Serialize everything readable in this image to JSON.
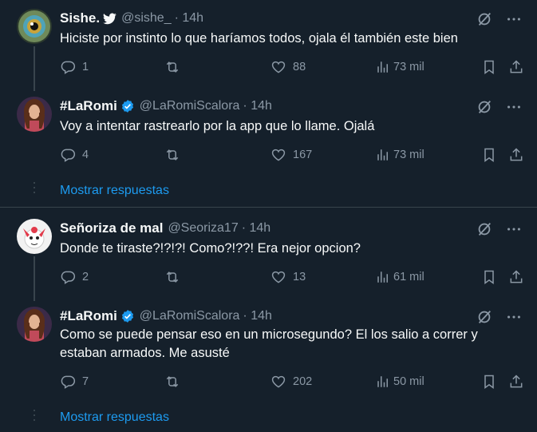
{
  "tweets": [
    {
      "name": "Sishe.",
      "handle": "@sishe_",
      "time": "· 14h",
      "text": "Hiciste por instinto lo que haríamos todos, ojala él también este bien",
      "replies": "1",
      "retweets": "",
      "likes": "88",
      "views": "73 mil"
    },
    {
      "name": "#LaRomi",
      "handle": "@LaRomiScalora",
      "time": "· 14h",
      "text": "Voy a intentar rastrearlo por la app que lo llame. Ojalá",
      "replies": "4",
      "retweets": "",
      "likes": "167",
      "views": "73 mil"
    },
    {
      "name": "Señoriza de mal",
      "handle": "@Seoriza17",
      "time": "· 14h",
      "text": "Donde te tiraste?!?!?! Como?!??! Era nejor opcion?",
      "replies": "2",
      "retweets": "",
      "likes": "13",
      "views": "61 mil"
    },
    {
      "name": "#LaRomi",
      "handle": "@LaRomiScalora",
      "time": "· 14h",
      "text": "Como se puede pensar eso en un microsegundo? El los salio a correr y estaban armados. Me asusté",
      "replies": "7",
      "retweets": "",
      "likes": "202",
      "views": "50 mil"
    }
  ],
  "show_replies_label": "Mostrar respuestas",
  "colors": {
    "background": "#15202b",
    "text": "#f7f9f9",
    "muted": "#8b98a5",
    "link": "#1d9bf0",
    "divider": "#38444d"
  }
}
